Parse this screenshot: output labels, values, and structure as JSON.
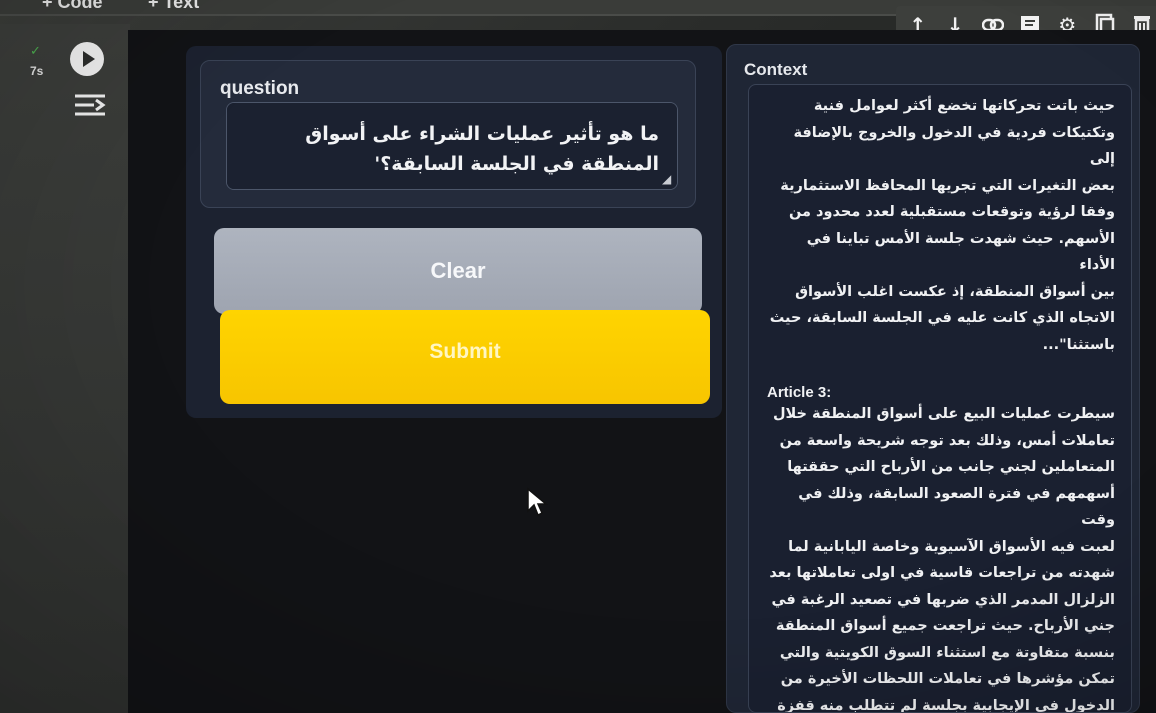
{
  "notebook": {
    "add_code_label": "+ Code",
    "add_text_label": "+ Text",
    "cell_status_check": "✓",
    "cell_exec_time": "7s"
  },
  "cell_toolbar": {
    "icons": [
      "arrow-up-icon",
      "arrow-down-icon",
      "link-icon",
      "comment-icon",
      "gear-icon",
      "mirror-cell-icon",
      "delete-icon"
    ]
  },
  "form": {
    "question_label": "question",
    "question_value": "ما هو تأثير عمليات الشراء على أسواق المنطقة في الجلسة السابقة؟'",
    "clear_label": "Clear",
    "submit_label": "Submit"
  },
  "context": {
    "label": "Context",
    "paragraph_1": "حيث باتت تحركاتها تخضع أكثر لعوامل فنية\nوتكتيكات فردية في الدخول والخروج بالإضافة إلى\nبعض التغيرات التي تجريها المحافظ الاستثمارية\nوفقا لرؤية وتوقعات مستقبلية لعدد محدود من\nالأسهم. حيث شهدت جلسة الأمس تباينا في الأداء\nبين أسواق المنطقة، إذ عكست اغلب الأسواق\nالاتجاه الذي كانت عليه في الجلسة السابقة، حيث\nباستثنا\"...",
    "article_3_heading": "Article 3:",
    "paragraph_2": "سيطرت عمليات البيع على أسواق المنطقة خلال\nتعاملات أمس، وذلك بعد توجه شريحة واسعة من\nالمتعاملين لجني جانب من الأرباح التي حققتها\nأسهمهم في فترة الصعود السابقة، وذلك في وقت\nلعبت فيه الأسواق الآسيوية وخاصة اليابانية لما\nشهدته من تراجعات قاسية في اولى تعاملاتها بعد\nالزلزال المدمر الذي ضربها في تصعيد الرغبة في\nجني الأرباح. حيث تراجعت جميع أسواق المنطقة\nبنسبة متفاوتة مع استثناء السوق الكويتية والتي\nتمكن مؤشرها في تعاملات اللحظات الأخيرة من\nالدخول في الإيجابية بجلسة لم تتطلب منه قفزة\nكبيرة لتعديل اتجا..."
  },
  "colors": {
    "submit": "#ffd400",
    "clear": "#aeb4bf",
    "panel": "#1c2230",
    "status_ok": "#4caf50"
  }
}
